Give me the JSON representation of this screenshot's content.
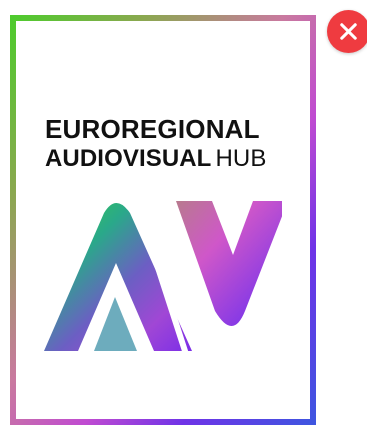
{
  "logo": {
    "line_1": "EUROREGIONAL",
    "line_2_bold": "AUDIOVISUAL",
    "line_2_light": "HUB",
    "mark_text": "AV",
    "gradient_colors": [
      "#4ccc2c",
      "#c9799f",
      "#c04bd1",
      "#6f33e7",
      "#3d56e0"
    ]
  },
  "close_button": {
    "icon": "close-icon",
    "color": "#ef3b40"
  }
}
